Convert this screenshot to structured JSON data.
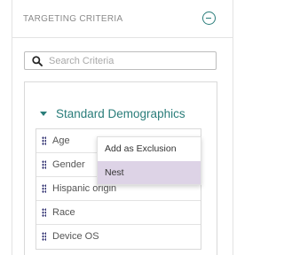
{
  "panel": {
    "title": "TARGETING CRITERIA",
    "collapse_icon": "minus-circle-icon",
    "accent_color": "#2a7d7a"
  },
  "search": {
    "placeholder": "Search Criteria",
    "value": "",
    "icon": "search-icon"
  },
  "group": {
    "title": "Standard Demographics",
    "expanded": true,
    "items": [
      {
        "label": "Age"
      },
      {
        "label": "Gender"
      },
      {
        "label": "Hispanic origin"
      },
      {
        "label": "Race"
      },
      {
        "label": "Device OS"
      }
    ]
  },
  "context_menu": {
    "items": [
      {
        "label": "Add as Exclusion",
        "highlighted": false
      },
      {
        "label": "Nest",
        "highlighted": true
      }
    ],
    "highlight_color": "#ddd3e6"
  }
}
